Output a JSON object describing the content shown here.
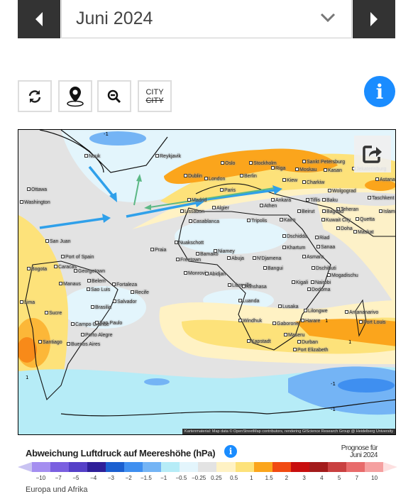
{
  "header": {
    "selected_month": "Juni 2024"
  },
  "toolbar": {
    "city_label_top": "CITY",
    "city_label_bottom": "CITY",
    "info": "i"
  },
  "map": {
    "credit": "Kartenmaterial: Map data © OpenStreetMap contributors, rendering GIScience Research Group @ Heidelberg University",
    "contour_labels": [
      "1",
      "1",
      "1",
      "-1",
      "-1",
      "-1"
    ],
    "cities": [
      "Nuuk",
      "Reykjavik",
      "Dublin",
      "London",
      "Oslo",
      "Stockholm",
      "Sankt Petersburg",
      "Riga",
      "Moskau",
      "Berlin",
      "Kasan",
      "Jekaterinburg",
      "Kiew",
      "Charkiw",
      "Paris",
      "Madrid",
      "Algier",
      "Lissabon",
      "Casablanca",
      "Wolgograd",
      "Tiflis",
      "Baku",
      "Ankara",
      "Athen",
      "Taschkent",
      "Astana",
      "Teheran",
      "Beirut",
      "Bagdad",
      "Islamabad",
      "Kairo",
      "Kuwait City",
      "Tripolis",
      "Quetta",
      "Doha",
      "Maskat",
      "Riad",
      "Dschidda",
      "Khartum",
      "Sanaa",
      "Asmara",
      "N'Djamena",
      "Niamey",
      "Nuakschott",
      "Praia",
      "Bamako",
      "Freetown",
      "Monrovia",
      "Abidjan",
      "Abuja",
      "Bangui",
      "Dschibuti",
      "Mogadischu",
      "Kigali",
      "Nairobi",
      "Libreville",
      "Kinshasa",
      "Dodoma",
      "Luanda",
      "Lusaka",
      "Lilongwe",
      "Antananarivo",
      "Harare",
      "Windhuk",
      "Gaborone",
      "Port Louis",
      "Maseru",
      "Durban",
      "Kapstadt",
      "Port Elizabeth",
      "Ottawa",
      "Washington",
      "San Juan",
      "Port of Spain",
      "Caracas",
      "Bogota",
      "Georgetown",
      "Manaus",
      "Belem",
      "Sao Luis",
      "Fortaleza",
      "Recife",
      "Salvador",
      "Brasilia",
      "Lima",
      "Sucre",
      "Campo Grande",
      "Sao Paulo",
      "Porto Alegre",
      "Santiago",
      "Buenos Aires"
    ]
  },
  "legend": {
    "title": "Abweichung Luftdruck auf Meereshöhe (hPa)",
    "info": "i",
    "forecast_line1": "Prognose für",
    "forecast_line2": "Juni 2024",
    "ticks": [
      "−10",
      "−7",
      "−5",
      "−4",
      "−3",
      "−2",
      "−1.5",
      "−1",
      "−0.5",
      "−0.25",
      "0.25",
      "0.5",
      "1",
      "1.5",
      "2",
      "3",
      "4",
      "5",
      "7",
      "10"
    ],
    "colors": [
      "#c9c3f2",
      "#a48ef0",
      "#7a5fe0",
      "#5540c8",
      "#2e1f99",
      "#1b5fd0",
      "#3f8ff0",
      "#74b4f5",
      "#b6ecf7",
      "#e3f5fc",
      "#e3e3e3",
      "#fff2c4",
      "#fde27a",
      "#fba51c",
      "#f14a12",
      "#c80e0e",
      "#a31b1b",
      "#c94040",
      "#e86b6b",
      "#f5a0a0",
      "#fde0e0"
    ],
    "region": "Europa und Afrika"
  }
}
